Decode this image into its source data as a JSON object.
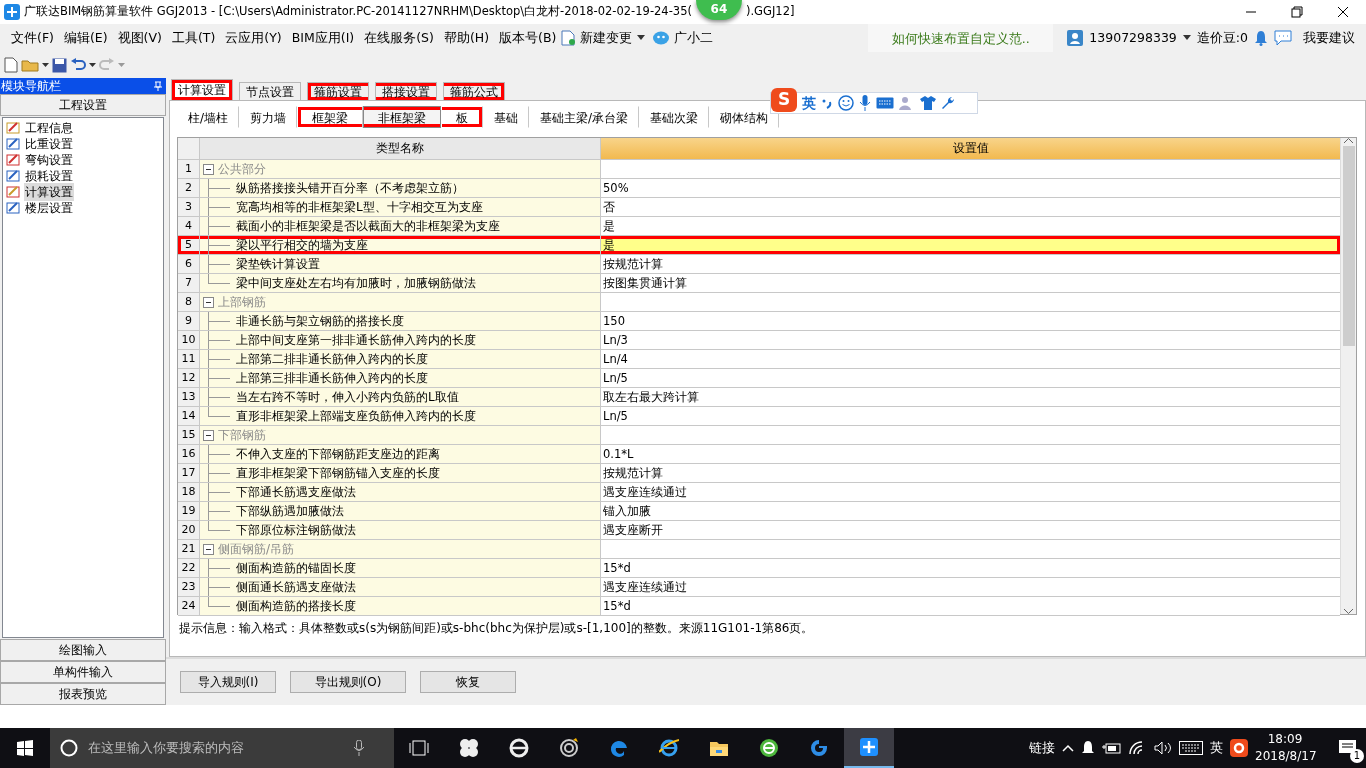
{
  "window": {
    "title": "广联达BIM钢筋算量软件 GGJ2013 - [C:\\Users\\Administrator.PC-20141127NRHM\\Desktop\\白龙村-2018-02-02-19-24-35(",
    "title_end": ").GGJ12]"
  },
  "floating_badge": "64",
  "menu": [
    "文件(F)",
    "编辑(E)",
    "视图(V)",
    "工具(T)",
    "云应用(Y)",
    "BIM应用(I)",
    "在线服务(S)",
    "帮助(H)",
    "版本号(B)"
  ],
  "new_change": "新建变更",
  "assistant": "广小二",
  "account": {
    "hint": "如何快速布置自定义范..",
    "phone": "13907298339",
    "beans": "造价豆:0",
    "suggest": "我要建议"
  },
  "navigator": {
    "title": "模块导航栏",
    "section": "工程设置",
    "items": [
      {
        "label": "工程信息",
        "selected": false
      },
      {
        "label": "比重设置",
        "selected": false
      },
      {
        "label": "弯钩设置",
        "selected": false
      },
      {
        "label": "损耗设置",
        "selected": false
      },
      {
        "label": "计算设置",
        "selected": true
      },
      {
        "label": "楼层设置",
        "selected": false
      }
    ],
    "bottom": [
      "绘图输入",
      "单构件输入",
      "报表预览"
    ]
  },
  "tabs": [
    {
      "label": "计算设置",
      "selected": true,
      "highlighted": true
    },
    {
      "label": "节点设置",
      "selected": false,
      "highlighted": false
    },
    {
      "label": "箍筋设置",
      "selected": false,
      "highlighted": true
    },
    {
      "label": "搭接设置",
      "selected": false,
      "highlighted": true
    },
    {
      "label": "箍筋公式",
      "selected": false,
      "highlighted": true
    }
  ],
  "subtabs": [
    {
      "label": "柱/墙柱",
      "selected": false,
      "highlighted": false
    },
    {
      "label": "剪力墙",
      "selected": false,
      "highlighted": false
    },
    {
      "label": "框架梁",
      "selected": false,
      "highlighted": true
    },
    {
      "label": "非框架梁",
      "selected": true,
      "highlighted": true
    },
    {
      "label": "板",
      "selected": false,
      "highlighted": true
    },
    {
      "label": "基础",
      "selected": false,
      "highlighted": false
    },
    {
      "label": "基础主梁/承台梁",
      "selected": false,
      "highlighted": false
    },
    {
      "label": "基础次梁",
      "selected": false,
      "highlighted": false
    },
    {
      "label": "砌体结构",
      "selected": false,
      "highlighted": false
    }
  ],
  "ime": {
    "logo": "S",
    "mode": "英"
  },
  "grid": {
    "columns": [
      "类型名称",
      "设置值"
    ],
    "groups": [
      {
        "num": "1",
        "label": "公共部分",
        "expanded": true,
        "children": [
          {
            "num": "2",
            "label": "纵筋搭接接头错开百分率（不考虑架立筋）",
            "value": "50%",
            "selected": false,
            "highlighted": false
          },
          {
            "num": "3",
            "label": "宽高均相等的非框架梁L型、十字相交互为支座",
            "value": "否",
            "selected": false,
            "highlighted": false
          },
          {
            "num": "4",
            "label": "截面小的非框架梁是否以截面大的非框架梁为支座",
            "value": "是",
            "selected": false,
            "highlighted": false
          },
          {
            "num": "5",
            "label": "梁以平行相交的墙为支座",
            "value": "是",
            "selected": true,
            "highlighted": true
          },
          {
            "num": "6",
            "label": "梁垫铁计算设置",
            "value": "按规范计算",
            "selected": false,
            "highlighted": false
          },
          {
            "num": "7",
            "label": "梁中间支座处左右均有加腋时，加腋钢筋做法",
            "value": "按图集贯通计算",
            "selected": false,
            "highlighted": false
          }
        ]
      },
      {
        "num": "8",
        "label": "上部钢筋",
        "expanded": true,
        "children": [
          {
            "num": "9",
            "label": "非通长筋与架立钢筋的搭接长度",
            "value": "150",
            "selected": false,
            "highlighted": false
          },
          {
            "num": "10",
            "label": "上部中间支座第一排非通长筋伸入跨内的长度",
            "value": "Ln/3",
            "selected": false,
            "highlighted": false
          },
          {
            "num": "11",
            "label": "上部第二排非通长筋伸入跨内的长度",
            "value": "Ln/4",
            "selected": false,
            "highlighted": false
          },
          {
            "num": "12",
            "label": "上部第三排非通长筋伸入跨内的长度",
            "value": "Ln/5",
            "selected": false,
            "highlighted": false
          },
          {
            "num": "13",
            "label": "当左右跨不等时，伸入小跨内负筋的L取值",
            "value": "取左右最大跨计算",
            "selected": false,
            "highlighted": false
          },
          {
            "num": "14",
            "label": "直形非框架梁上部端支座负筋伸入跨内的长度",
            "value": "Ln/5",
            "selected": false,
            "highlighted": false
          }
        ]
      },
      {
        "num": "15",
        "label": "下部钢筋",
        "expanded": true,
        "children": [
          {
            "num": "16",
            "label": "不伸入支座的下部钢筋距支座边的距离",
            "value": "0.1*L",
            "selected": false,
            "highlighted": false
          },
          {
            "num": "17",
            "label": "直形非框架梁下部钢筋锚入支座的长度",
            "value": "按规范计算",
            "selected": false,
            "highlighted": false
          },
          {
            "num": "18",
            "label": "下部通长筋遇支座做法",
            "value": "遇支座连续通过",
            "selected": false,
            "highlighted": false
          },
          {
            "num": "19",
            "label": "下部纵筋遇加腋做法",
            "value": "锚入加腋",
            "selected": false,
            "highlighted": false
          },
          {
            "num": "20",
            "label": "下部原位标注钢筋做法",
            "value": "遇支座断开",
            "selected": false,
            "highlighted": false
          }
        ]
      },
      {
        "num": "21",
        "label": "侧面钢筋/吊筋",
        "expanded": true,
        "children": [
          {
            "num": "22",
            "label": "侧面构造筋的锚固长度",
            "value": "15*d",
            "selected": false,
            "highlighted": false
          },
          {
            "num": "23",
            "label": "侧面通长筋遇支座做法",
            "value": "遇支座连续通过",
            "selected": false,
            "highlighted": false
          },
          {
            "num": "24",
            "label": "侧面构造筋的搭接长度",
            "value": "15*d",
            "selected": false,
            "highlighted": false
          }
        ]
      }
    ]
  },
  "hint": "提示信息：输入格式：具体整数或s(s为钢筋间距)或s-bhc(bhc为保护层)或s-[1,100]的整数。来源11G101-1第86页。",
  "buttons": [
    "导入规则(I)",
    "导出规则(O)",
    "恢复"
  ],
  "taskbar": {
    "search_placeholder": "在这里输入你要搜索的内容",
    "links": "链接",
    "ime": "英",
    "time": "18:09",
    "date": "2018/8/17",
    "notifications": "1"
  }
}
